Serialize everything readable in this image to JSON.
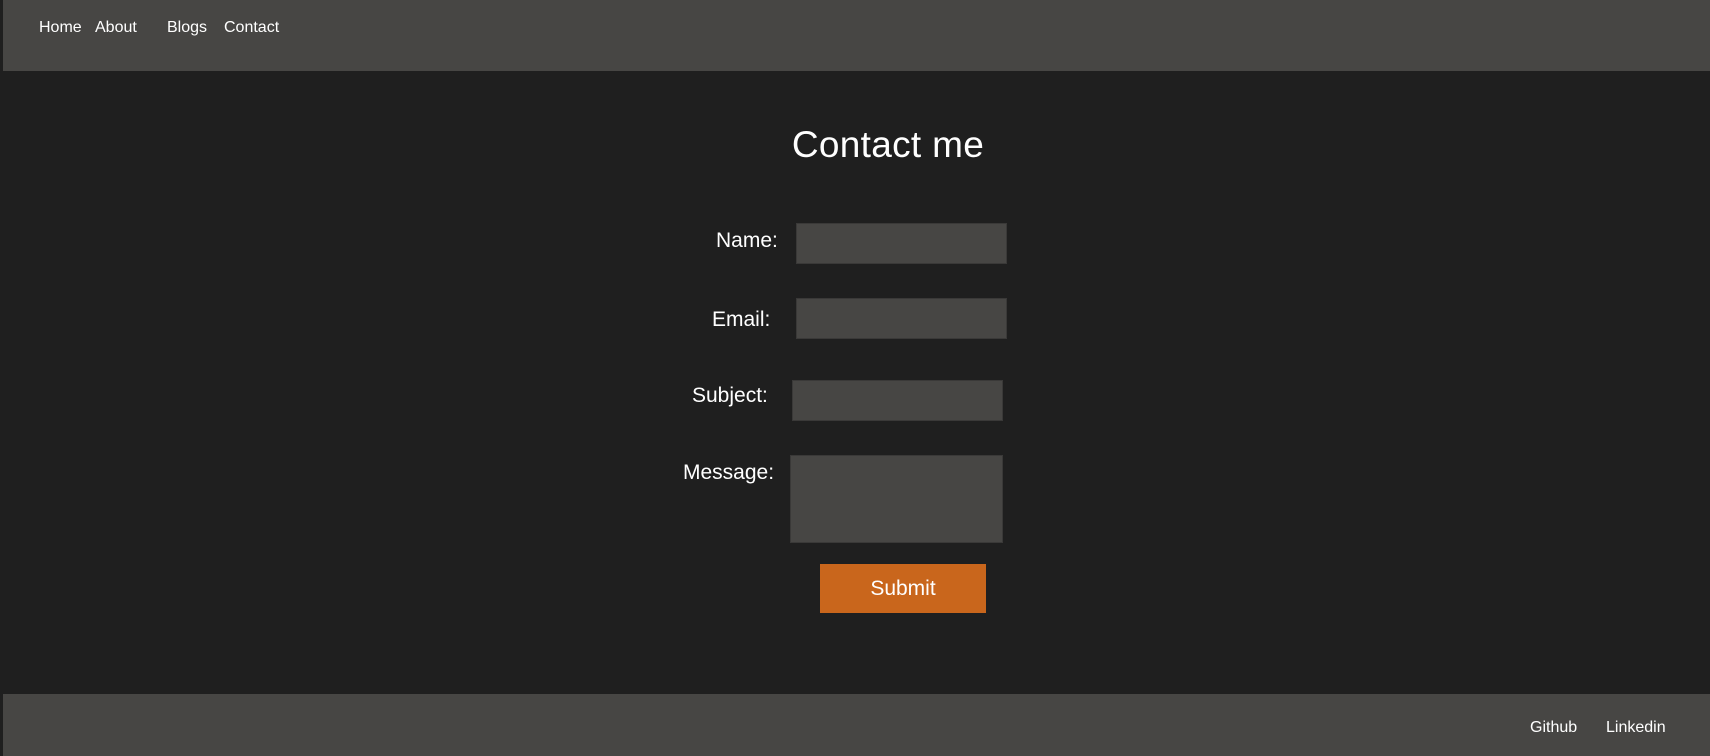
{
  "nav": {
    "items": [
      {
        "label": "Home"
      },
      {
        "label": "About"
      },
      {
        "label": "Blogs"
      },
      {
        "label": "Contact"
      }
    ]
  },
  "main": {
    "title": "Contact me",
    "form": {
      "name_label": "Name:",
      "name_value": "",
      "email_label": "Email:",
      "email_value": "",
      "subject_label": "Subject:",
      "subject_value": "",
      "message_label": "Message:",
      "message_value": "",
      "submit_label": "Submit"
    }
  },
  "footer": {
    "links": [
      {
        "label": "Github"
      },
      {
        "label": "Linkedin"
      }
    ]
  },
  "colors": {
    "background": "#1f1f1f",
    "bar": "#474644",
    "accent": "#c9661c",
    "text": "#ffffff"
  }
}
